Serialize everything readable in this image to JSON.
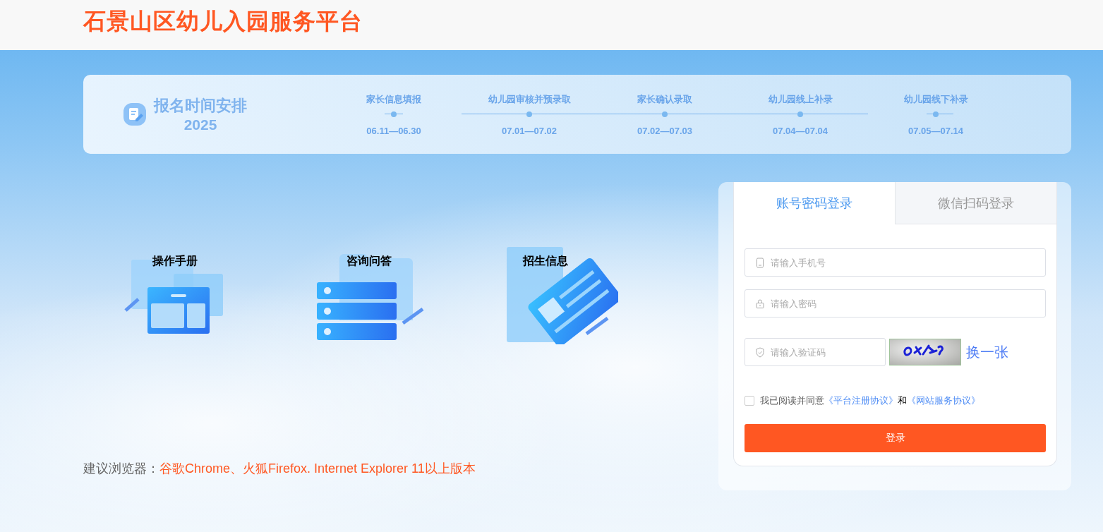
{
  "header": {
    "title": "石景山区幼儿入园服务平台"
  },
  "schedule": {
    "title": "报名时间安排",
    "year": "2025",
    "steps": [
      {
        "label": "家长信息填报",
        "date": "06.11—06.30"
      },
      {
        "label": "幼儿园审核并预录取",
        "date": "07.01—07.02"
      },
      {
        "label": "家长确认录取",
        "date": "07.02—07.03"
      },
      {
        "label": "幼儿园线上补录",
        "date": "07.04—07.04"
      },
      {
        "label": "幼儿园线下补录",
        "date": "07.05—07.14"
      }
    ]
  },
  "quick_links": [
    {
      "kind": "manual",
      "label": "操作手册"
    },
    {
      "kind": "faq",
      "label": "咨询问答"
    },
    {
      "kind": "news",
      "label": "招生信息"
    }
  ],
  "browser_note": {
    "label": "建议浏览器：",
    "value": "谷歌Chrome、火狐Firefox. Internet Explorer 11以上版本"
  },
  "login": {
    "tabs": [
      {
        "label": "账号密码登录",
        "selected": true
      },
      {
        "label": "微信扫码登录",
        "selected": false
      }
    ],
    "fields": [
      {
        "kind": "phone",
        "placeholder": "请输入手机号"
      },
      {
        "kind": "password",
        "placeholder": "请输入密码"
      },
      {
        "kind": "captcha",
        "placeholder": "请输入验证码"
      }
    ],
    "captcha_refresh": "换一张",
    "agreement": {
      "checked": false,
      "text": "我已阅读并同意",
      "link_1": "《平台注册协议》",
      "conjunction": "和",
      "link_2": "《网站服务协议》"
    },
    "submit": "登录"
  }
}
